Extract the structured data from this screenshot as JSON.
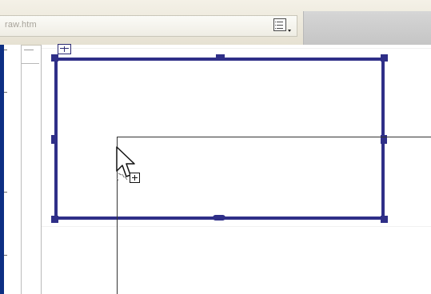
{
  "window": {
    "address": "raw.htm"
  },
  "toolbar": {
    "menu_button_label": ""
  },
  "canvas": {
    "selection": "table-container"
  },
  "cursor": {
    "mode": "move-copy"
  },
  "colors": {
    "selection_border": "#2f2f88",
    "left_edge": "#0d2f83",
    "toolbar": "#eeeae0"
  },
  "icons": {
    "menu": "list-menu-icon",
    "table": "table-icon",
    "cursor": "move-copy-cursor-icon"
  }
}
